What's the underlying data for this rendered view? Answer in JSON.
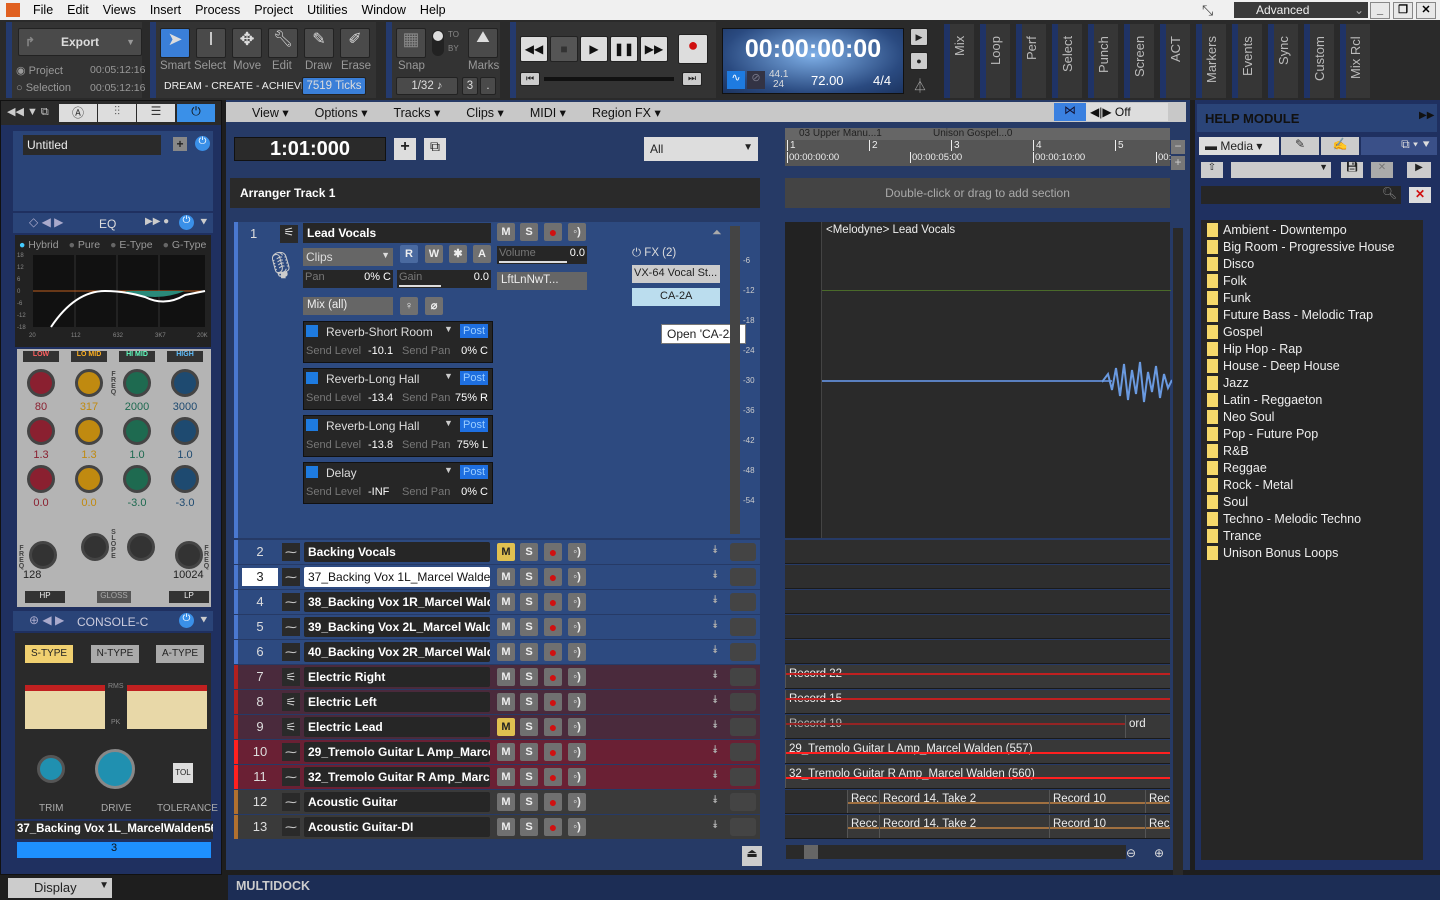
{
  "menu": [
    "File",
    "Edit",
    "Views",
    "Insert",
    "Process",
    "Project",
    "Utilities",
    "Window",
    "Help"
  ],
  "workspace": "Advanced",
  "window_controls": [
    "_",
    "❐",
    "✕"
  ],
  "control_bar": {
    "export": "Export",
    "project_label": "Project",
    "project_time": "00:05:12:16",
    "selection_label": "Selection",
    "selection_time": "00:05:12:16",
    "tools": [
      "Smart",
      "Select",
      "Move",
      "Edit",
      "Draw",
      "Erase"
    ],
    "tagline": "DREAM - CREATE - ACHIEVE",
    "ticks": "7519 Ticks",
    "snap_label": "Snap",
    "to": "TO",
    "by": "BY",
    "marks_label": "Marks",
    "snap_value": "1/32",
    "snap_num": "3",
    "snap_dot": ".",
    "time": "00:00:00:00",
    "sample_rate": "44.1",
    "bit_depth": "24",
    "tempo": "72.00",
    "meter": "4/4",
    "modules": [
      "Mix",
      "Loop",
      "Perf",
      "Select",
      "Punch",
      "Screen",
      "ACT",
      "Markers",
      "Events",
      "Sync",
      "Custom",
      "Mix Rcl"
    ]
  },
  "inspector": {
    "preset": "Untitled",
    "eq_title": "EQ",
    "eq_modes": [
      "Hybrid",
      "Pure",
      "E-Type",
      "G-Type"
    ],
    "eq_y_ticks": [
      "18",
      "12",
      "6",
      "0",
      "-6",
      "-12",
      "-18"
    ],
    "eq_x_ticks": [
      "20",
      "112",
      "632",
      "3K7",
      "20K"
    ],
    "bands": [
      {
        "name": "LOW",
        "freq": "80",
        "q": "1.3",
        "level": "0.0",
        "color": "#8a2030",
        "label": "#ff6060"
      },
      {
        "name": "LO MID",
        "freq": "317",
        "q": "1.3",
        "level": "0.0",
        "color": "#c08a10",
        "label": "#ffb020"
      },
      {
        "name": "HI MID",
        "freq": "2000",
        "q": "1.0",
        "level": "-3.0",
        "color": "#1e6a50",
        "label": "#60ffc0"
      },
      {
        "name": "HIGH",
        "freq": "3000",
        "q": "1.0",
        "level": "-3.0",
        "color": "#1e4a70",
        "label": "#60c0ff"
      }
    ],
    "hp": "HP",
    "hp_value": "128",
    "lp": "LP",
    "lp_value": "10024",
    "gloss": "GLOSS",
    "freq": "FREQ",
    "slope": "SLOPE",
    "console_title": "CONSOLE-C",
    "console_types": [
      "S-TYPE",
      "N-TYPE",
      "A-TYPE"
    ],
    "rms": "RMS",
    "pk": "PK",
    "trim": "TRIM",
    "drive": "DRIVE",
    "tolerance": "TOLERANCE",
    "tol": "TOL",
    "track_name": "37_Backing Vox 1L_MarcelWalden562",
    "track_num": "3",
    "display": "Display"
  },
  "trackview": {
    "menu": [
      "View",
      "Options",
      "Tracks",
      "Clips",
      "MIDI",
      "Region FX"
    ],
    "now": "1:01:000",
    "filter": "All",
    "arranger": "Arranger Track 1",
    "snap_off": "Off",
    "sections": [
      "03  Upper Manu...1",
      "Unison Gospel...0"
    ],
    "bars": [
      "1",
      "2",
      "3",
      "4",
      "5"
    ],
    "times": [
      "00:00:00:00",
      "00:00:05:00",
      "00:00:10:00",
      "00:"
    ],
    "add_section_hint": "Double-click or drag to add section",
    "lead": {
      "num": "1",
      "name": "Lead Vocals",
      "clips": "Clips",
      "pan_label": "Pan",
      "pan": "0% C",
      "gain_label": "Gain",
      "gain": "0.0",
      "volume_label": "Volume",
      "volume": "0.0",
      "input": "LftLnNwT...",
      "output": "Mix (all)",
      "fx": "FX (2)",
      "fx1": "VX-64 Vocal St...",
      "fx2": "CA-2A",
      "tooltip": "Open 'CA-2A'",
      "sends": [
        {
          "name": "Reverb-Short Room",
          "level": "-10.1",
          "pan": "0% C"
        },
        {
          "name": "Reverb-Long Hall",
          "level": "-13.4",
          "pan": "75% R"
        },
        {
          "name": "Reverb-Long Hall",
          "level": "-13.8",
          "pan": "75% L"
        },
        {
          "name": "Delay",
          "level": "-INF",
          "pan": "0% C"
        }
      ],
      "send_level_label": "Send Level",
      "send_pan_label": "Send Pan",
      "post": "Post",
      "meter_ticks": [
        "-6",
        "-12",
        "-18",
        "-24",
        "-30",
        "-36",
        "-42",
        "-48",
        "-54"
      ],
      "clip_name": "<Melodyne> Lead Vocals"
    },
    "tracks": [
      {
        "num": "2",
        "name": "Backing Vocals",
        "mute": true,
        "group": "blue"
      },
      {
        "num": "3",
        "name": "37_Backing Vox 1L_Marcel Walden",
        "mute": false,
        "group": "blue",
        "selected": true
      },
      {
        "num": "4",
        "name": "38_Backing Vox 1R_Marcel Walden",
        "mute": false,
        "group": "blue"
      },
      {
        "num": "5",
        "name": "39_Backing Vox 2L_Marcel Walden",
        "mute": false,
        "group": "blue"
      },
      {
        "num": "6",
        "name": "40_Backing Vox 2R_Marcel Walden",
        "mute": false,
        "group": "blue"
      },
      {
        "num": "7",
        "name": "Electric Right",
        "mute": false,
        "group": "maroon",
        "clips": [
          "Record 22"
        ]
      },
      {
        "num": "8",
        "name": "Electric Left",
        "mute": false,
        "group": "maroon",
        "clips": [
          "Record 15"
        ]
      },
      {
        "num": "9",
        "name": "Electric Lead",
        "mute": true,
        "group": "maroon",
        "clips": [
          "Record 19",
          "ord"
        ]
      },
      {
        "num": "10",
        "name": "29_Tremolo Guitar L Amp_Marcel Walden",
        "mute": false,
        "group": "red",
        "clips": [
          "29_Tremolo Guitar L Amp_Marcel Walden (557)"
        ]
      },
      {
        "num": "11",
        "name": "32_Tremolo Guitar R Amp_Marcel Walden",
        "mute": false,
        "group": "red",
        "clips": [
          "32_Tremolo Guitar R Amp_Marcel Walden (560)"
        ]
      },
      {
        "num": "12",
        "name": "Acoustic Guitar",
        "mute": false,
        "group": "brown",
        "clips": [
          "Recc",
          "Record 14, Take 2",
          "Record 10",
          "Rec"
        ]
      },
      {
        "num": "13",
        "name": "Acoustic Guitar-DI",
        "mute": false,
        "group": "brown",
        "clips": [
          "Recc",
          "Record 14, Take 2",
          "Record 10",
          "Rec"
        ]
      }
    ],
    "button_labels": {
      "mute": "M",
      "solo": "S"
    }
  },
  "browser": {
    "title": "HELP MODULE",
    "tab": "Media",
    "folders": [
      "Ambient - Downtempo",
      "Big Room - Progressive House",
      "Disco",
      "Folk",
      "Funk",
      "Future Bass - Melodic Trap",
      "Gospel",
      "Hip Hop - Rap",
      "House - Deep House",
      "Jazz",
      "Latin - Reggaeton",
      "Neo Soul",
      "Pop - Future Pop",
      "R&B",
      "Reggae",
      "Rock - Metal",
      "Soul",
      "Techno - Melodic Techno",
      "Trance",
      "Unison Bonus Loops"
    ]
  },
  "multidock": "MULTIDOCK",
  "colors": {
    "accent": "#1e7be0",
    "mute_on": "#e0c050",
    "record": "#d01010",
    "panel": "#263a66"
  }
}
